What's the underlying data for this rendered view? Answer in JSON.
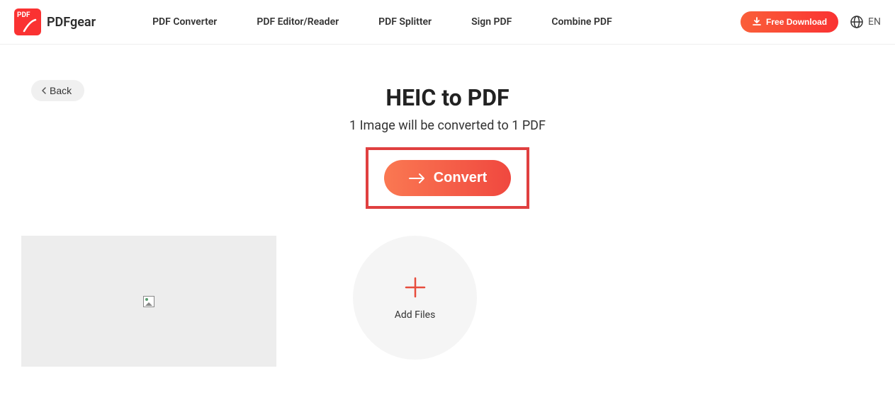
{
  "header": {
    "brand": "PDFgear",
    "logo_text": "PDF",
    "nav": [
      "PDF Converter",
      "PDF Editor/Reader",
      "PDF Splitter",
      "Sign PDF",
      "Combine PDF"
    ],
    "download_label": "Free Download",
    "lang_label": "EN"
  },
  "main": {
    "back_label": "Back",
    "title": "HEIC to PDF",
    "subtitle": "1 Image will be converted to 1 PDF",
    "convert_label": "Convert",
    "add_files_label": "Add Files"
  }
}
